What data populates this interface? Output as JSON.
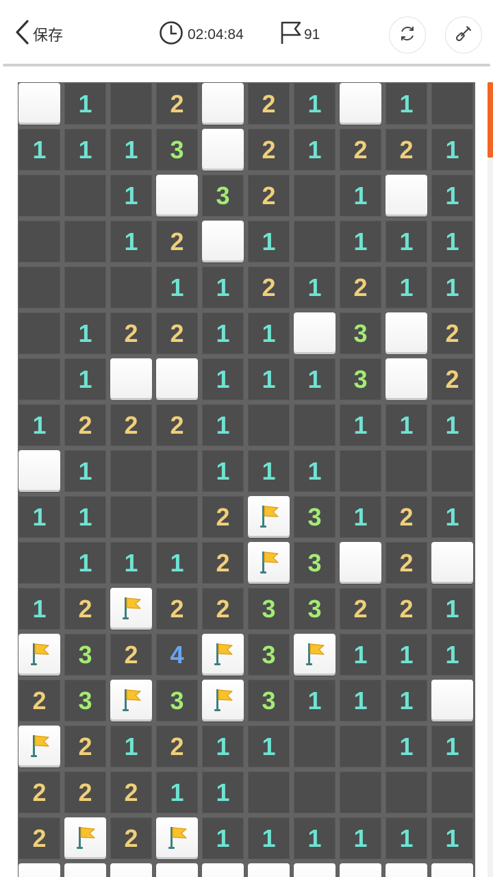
{
  "header": {
    "back_label": "保存",
    "timer": "02:04:84",
    "flag_count": "91",
    "icons": {
      "back": "chevron-left-icon",
      "timer": "clock-icon",
      "flag": "flag-icon",
      "refresh": "refresh-icon",
      "tool": "shovel-icon"
    }
  },
  "board": {
    "columns": 10,
    "legend": "C = covered cell, F = flagged cell, 0 = revealed empty, 1-4 = revealed number",
    "colors": {
      "1": "#6fe3d2",
      "2": "#f0cf7a",
      "3": "#a3ec73",
      "4": "#6aa6f0",
      "accent": "#f26522"
    },
    "rows": [
      [
        "C",
        "1",
        "0",
        "2",
        "C",
        "2",
        "1",
        "C",
        "1",
        "0"
      ],
      [
        "1",
        "1",
        "1",
        "3",
        "C",
        "2",
        "1",
        "2",
        "2",
        "1"
      ],
      [
        "0",
        "0",
        "1",
        "C",
        "3",
        "2",
        "0",
        "1",
        "C",
        "1"
      ],
      [
        "0",
        "0",
        "1",
        "2",
        "C",
        "1",
        "0",
        "1",
        "1",
        "1"
      ],
      [
        "0",
        "0",
        "0",
        "1",
        "1",
        "2",
        "1",
        "2",
        "1",
        "1"
      ],
      [
        "0",
        "1",
        "2",
        "2",
        "1",
        "1",
        "C",
        "3",
        "C",
        "2"
      ],
      [
        "0",
        "1",
        "C",
        "C",
        "1",
        "1",
        "1",
        "3",
        "C",
        "2"
      ],
      [
        "1",
        "2",
        "2",
        "2",
        "1",
        "0",
        "0",
        "1",
        "1",
        "1"
      ],
      [
        "C",
        "1",
        "0",
        "0",
        "1",
        "1",
        "1",
        "0",
        "0",
        "0"
      ],
      [
        "1",
        "1",
        "0",
        "0",
        "2",
        "F",
        "3",
        "1",
        "2",
        "1"
      ],
      [
        "0",
        "1",
        "1",
        "1",
        "2",
        "F",
        "3",
        "C",
        "2",
        "C"
      ],
      [
        "1",
        "2",
        "F",
        "2",
        "2",
        "3",
        "3",
        "2",
        "2",
        "1"
      ],
      [
        "F",
        "3",
        "2",
        "4",
        "F",
        "3",
        "F",
        "1",
        "1",
        "1"
      ],
      [
        "2",
        "3",
        "F",
        "3",
        "F",
        "3",
        "1",
        "1",
        "1",
        "C"
      ],
      [
        "F",
        "2",
        "1",
        "2",
        "1",
        "1",
        "0",
        "0",
        "1",
        "1"
      ],
      [
        "2",
        "2",
        "2",
        "1",
        "1",
        "0",
        "0",
        "0",
        "0",
        "0"
      ],
      [
        "2",
        "F",
        "2",
        "F",
        "1",
        "1",
        "1",
        "1",
        "1",
        "1"
      ],
      [
        "C",
        "C",
        "C",
        "C",
        "C",
        "C",
        "C",
        "C",
        "C",
        "C"
      ]
    ]
  }
}
